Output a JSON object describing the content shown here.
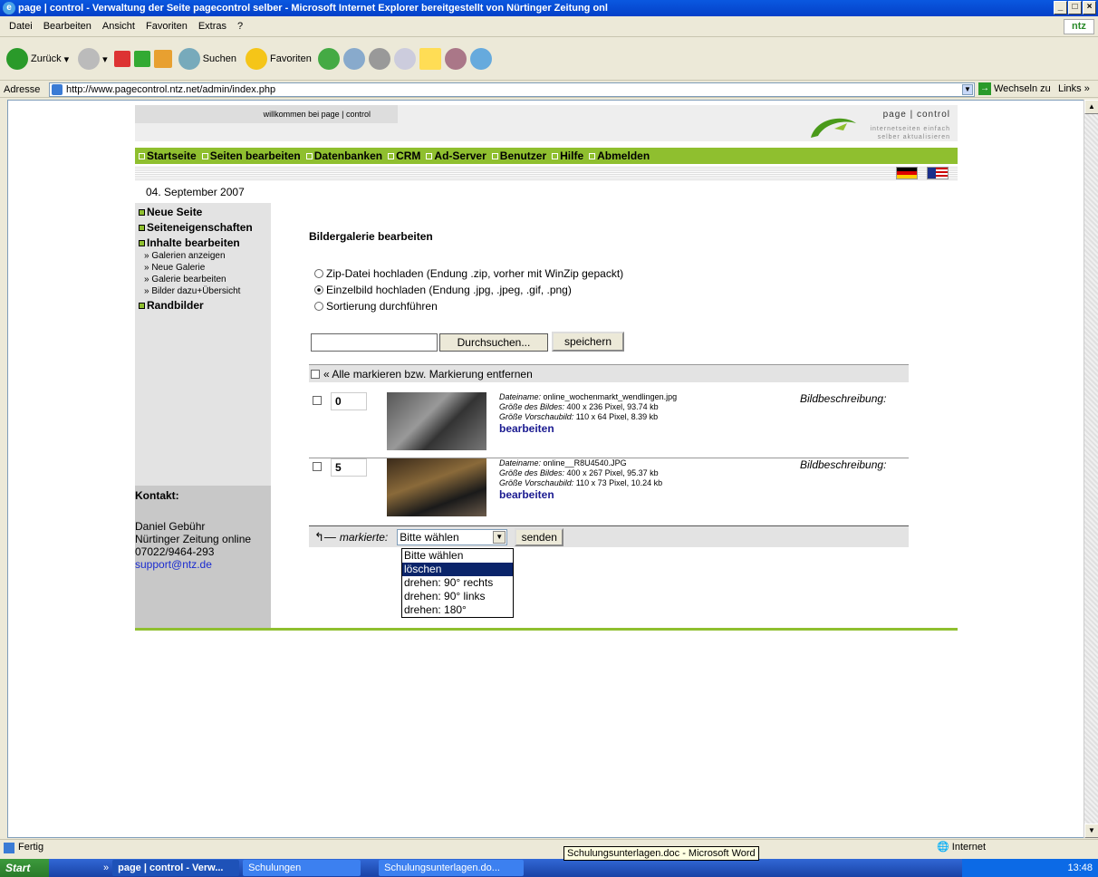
{
  "window": {
    "title": "page | control - Verwaltung der Seite pagecontrol selber - Microsoft Internet Explorer bereitgestellt von Nürtinger Zeitung onl"
  },
  "menu": [
    "Datei",
    "Bearbeiten",
    "Ansicht",
    "Favoriten",
    "Extras",
    "?"
  ],
  "menu_logo": "ntz",
  "toolbar": {
    "back": "Zurück",
    "search": "Suchen",
    "favorites": "Favoriten"
  },
  "address": {
    "label": "Adresse",
    "url": "http://www.pagecontrol.ntz.net/admin/index.php",
    "go": "Wechseln zu",
    "links": "Links"
  },
  "site": {
    "welcome": "willkommen bei page | control",
    "brand": "page | control",
    "tagline1": "internetseiten einfach",
    "tagline2": "selber aktualisieren",
    "nav": [
      "Startseite",
      "Seiten bearbeiten",
      "Datenbanken",
      "CRM",
      "Ad-Server",
      "Benutzer",
      "Hilfe",
      "Abmelden"
    ],
    "date": "04. September 2007",
    "sidebar": {
      "item1": "Neue Seite",
      "item2": "Seiteneigenschaften",
      "item3": "Inhalte bearbeiten",
      "sub": [
        "» Galerien anzeigen",
        "» Neue Galerie",
        "» Galerie bearbeiten",
        "» Bilder dazu+Übersicht"
      ],
      "item4": "Randbilder"
    },
    "contact": {
      "heading": "Kontakt:",
      "name": "Daniel Gebühr",
      "org": "Nürtinger Zeitung online",
      "phone": "07022/9464-293",
      "email": "support@ntz.de"
    },
    "heading": "Bildergalerie bearbeiten",
    "radios": [
      "Zip-Datei hochladen (Endung .zip, vorher mit WinZip gepackt)",
      "Einzelbild hochladen (Endung .jpg, .jpeg, .gif, .png)",
      "Sortierung durchführen"
    ],
    "radio_selected": 1,
    "browse": "Durchsuchen...",
    "save": "speichern",
    "markall": "« Alle markieren bzw. Markierung entfernen",
    "rows": [
      {
        "order": "0",
        "fname_label": "Dateiname:",
        "fname": "online_wochenmarkt_wendlingen.jpg",
        "size_label": "Größe des Bildes:",
        "size": "400 x 236 Pixel, 93.74 kb",
        "thumb_label": "Größe Vorschaubild:",
        "thumb": "110 x 64 Pixel, 8.39 kb",
        "edit": "bearbeiten",
        "desc": "Bildbeschreibung:"
      },
      {
        "order": "5",
        "fname_label": "Dateiname:",
        "fname": "online__R8U4540.JPG",
        "size_label": "Größe des Bildes:",
        "size": "400 x 267 Pixel, 95.37 kb",
        "thumb_label": "Größe Vorschaubild:",
        "thumb": "110 x 73 Pixel, 10.24 kb",
        "edit": "bearbeiten",
        "desc": "Bildbeschreibung:"
      }
    ],
    "marked_label": "markierte:",
    "select_value": "Bitte wählen",
    "send": "senden",
    "options": [
      "Bitte wählen",
      "löschen",
      "drehen: 90° rechts",
      "drehen: 90° links",
      "drehen: 180°"
    ]
  },
  "status": {
    "text": "Fertig",
    "zone": "Internet"
  },
  "tooltip": "Schulungsunterlagen.doc - Microsoft Word",
  "taskbar": {
    "start": "Start",
    "task1": "page | control - Verw...",
    "task2": "Schulungen",
    "task3": "Schulungsunterlagen.do...",
    "clock": "13:48"
  }
}
